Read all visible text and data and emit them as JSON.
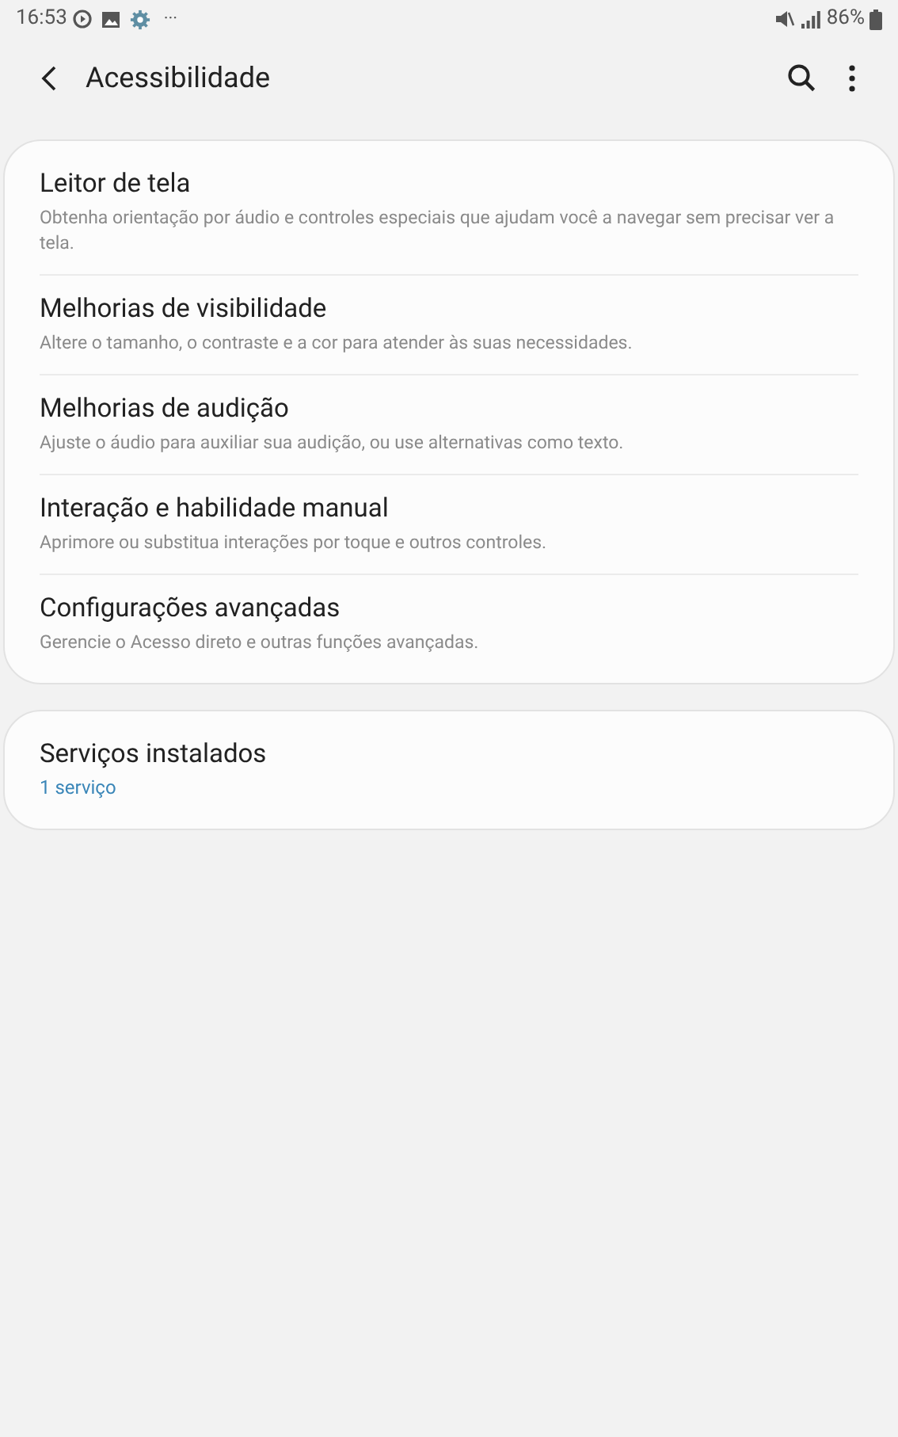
{
  "status_bar": {
    "time": "16:53",
    "overflow": "···",
    "battery": "86%"
  },
  "header": {
    "title": "Acessibilidade"
  },
  "groups": [
    {
      "items": [
        {
          "kind": "detail",
          "title": "Leitor de tela",
          "subtitle": "Obtenha orientação por áudio e controles especiais que ajudam você a navegar sem precisar ver a tela."
        },
        {
          "kind": "detail",
          "title": "Melhorias de visibilidade",
          "subtitle": "Altere o tamanho, o contraste e a cor para atender às suas necessidades."
        },
        {
          "kind": "detail",
          "title": "Melhorias de audição",
          "subtitle": "Ajuste o áudio para auxiliar sua audição, ou use alternativas como texto."
        },
        {
          "kind": "detail",
          "title": "Interação e habilidade manual",
          "subtitle": "Aprimore ou substitua interações por toque e outros controles."
        },
        {
          "kind": "detail",
          "title": "Configurações avançadas",
          "subtitle": "Gerencie o Acesso direto e outras funções avançadas."
        }
      ]
    },
    {
      "items": [
        {
          "kind": "status",
          "title": "Serviços instalados",
          "subtitle": "1 serviço"
        }
      ]
    }
  ]
}
